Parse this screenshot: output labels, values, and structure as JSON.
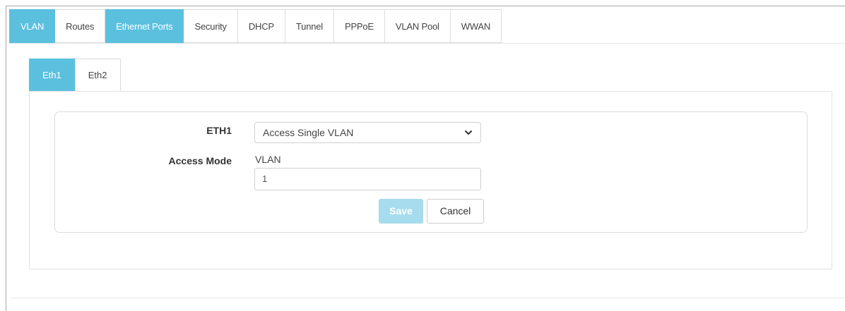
{
  "top_tabs": [
    {
      "label": "VLAN",
      "state": "active"
    },
    {
      "label": "Routes",
      "state": "normal"
    },
    {
      "label": "Ethernet Ports",
      "state": "highlight"
    },
    {
      "label": "Security",
      "state": "normal"
    },
    {
      "label": "DHCP",
      "state": "normal"
    },
    {
      "label": "Tunnel",
      "state": "normal"
    },
    {
      "label": "PPPoE",
      "state": "normal"
    },
    {
      "label": "VLAN Pool",
      "state": "normal"
    },
    {
      "label": "WWAN",
      "state": "normal"
    }
  ],
  "sub_tabs": [
    {
      "label": "Eth1",
      "state": "active"
    },
    {
      "label": "Eth2",
      "state": "normal"
    }
  ],
  "form": {
    "eth1_label": "ETH1",
    "eth1_value": "Access Single VLAN",
    "access_mode_label": "Access Mode",
    "vlan_caption": "VLAN",
    "vlan_value": "1",
    "save_label": "Save",
    "cancel_label": "Cancel"
  },
  "colors": {
    "accent": "#5bc0de",
    "save_disabled": "#a6dced"
  },
  "icons": {
    "select_chevron": "chevron-down-icon"
  }
}
